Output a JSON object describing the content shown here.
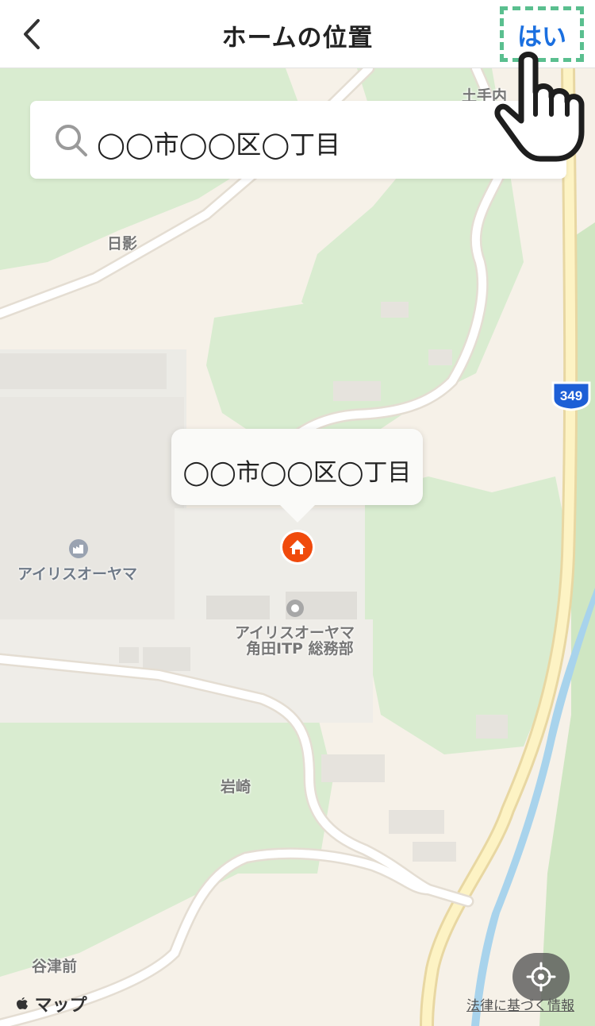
{
  "header": {
    "title": "ホームの位置",
    "confirm_label": "はい"
  },
  "search": {
    "value": "◯◯市◯◯区◯丁目"
  },
  "callout": {
    "text": "◯◯市◯◯区◯丁目"
  },
  "map": {
    "labels": {
      "dotenai": "土手内",
      "hikage": "日影",
      "iris_factory": "アイリスオーヤマ",
      "iris_itp_line1": "アイリスオーヤマ",
      "iris_itp_line2": "角田ITP 総務部",
      "iwasaki": "岩崎",
      "yatsumae": "谷津前"
    },
    "route_shield": "349",
    "attribution": "マップ",
    "legal": "法律に基づく情報"
  },
  "colors": {
    "accent": "#1a6fe0",
    "highlight": "#5abf8f",
    "home_pin": "#f04a0c"
  }
}
